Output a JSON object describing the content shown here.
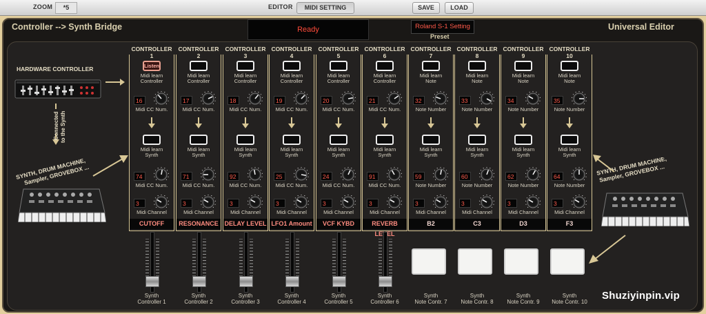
{
  "toolbar": {
    "zoom_label": "ZOOM",
    "zoom_value": "*5",
    "editor_label": "EDITOR",
    "midi_setting_label": "MIDI SETTING",
    "save_label": "SAVE",
    "load_label": "LOAD"
  },
  "header": {
    "title_left": "Controller --> Synth Bridge",
    "title_right": "Universal Editor",
    "status": "Ready",
    "preset_value": "Roland S-1 Setting",
    "preset_label": "Preset"
  },
  "left_panel": {
    "hardware_label": "HARDWARE CONTROLLER",
    "connected_line1": "Connected",
    "connected_line2": "to the Synth",
    "synth_label_line1": "SYNTH, DRUM MACHINE,",
    "synth_label_line2": "Sampler, GROVEBOX ..."
  },
  "right_panel": {
    "synth_label_line1": "SYNTH, DRUM MACHINE,",
    "synth_label_line2": "Sampler, GROVEBOX ..."
  },
  "controllers": [
    {
      "head": "CONTROLLER",
      "num": "1",
      "learn_ctrl": "Midi learn",
      "learn_ctrl2": "Controller",
      "listen": "Listen",
      "cc_in": "16",
      "cc_in_label": "Midi CC Num.",
      "learn_synth": "Midi learn",
      "learn_synth2": "Synth",
      "cc_out": "74",
      "cc_out_label": "Midi CC Num.",
      "channel": "3",
      "channel_label": "Midi Channel",
      "name": "CUTOFF",
      "fader_label1": "Synth",
      "fader_label2": "Controller 1"
    },
    {
      "head": "CONTROLLER",
      "num": "2",
      "learn_ctrl": "Midi learn",
      "learn_ctrl2": "Controller",
      "cc_in": "17",
      "cc_in_label": "Midi CC Num.",
      "learn_synth": "Midi learn",
      "learn_synth2": "Synth",
      "cc_out": "71",
      "cc_out_label": "Midi CC Num.",
      "channel": "3",
      "channel_label": "Midi Channel",
      "name": "RESONANCE",
      "fader_label1": "Synth",
      "fader_label2": "Controller 2"
    },
    {
      "head": "CONTROLLER",
      "num": "3",
      "learn_ctrl": "Midi learn",
      "learn_ctrl2": "Controller",
      "cc_in": "18",
      "cc_in_label": "Midi CC Num.",
      "learn_synth": "Midi learn",
      "learn_synth2": "Synth",
      "cc_out": "92",
      "cc_out_label": "Midi CC Num.",
      "channel": "3",
      "channel_label": "Midi Channel",
      "name": "DELAY LEVEL",
      "fader_label1": "Synth",
      "fader_label2": "Controller 3"
    },
    {
      "head": "CONTROLLER",
      "num": "4",
      "learn_ctrl": "Midi learn",
      "learn_ctrl2": "Controller",
      "cc_in": "19",
      "cc_in_label": "Midi CC Num.",
      "learn_synth": "Midi learn",
      "learn_synth2": "Synth",
      "cc_out": "25",
      "cc_out_label": "Midi CC Num.",
      "channel": "3",
      "channel_label": "Midi Channel",
      "name": "LFO1 Amount",
      "fader_label1": "Synth",
      "fader_label2": "Controller 4"
    },
    {
      "head": "CONTROLLER",
      "num": "5",
      "learn_ctrl": "Midi learn",
      "learn_ctrl2": "Controller",
      "cc_in": "20",
      "cc_in_label": "Midi CC Num.",
      "learn_synth": "Midi learn",
      "learn_synth2": "Synth",
      "cc_out": "24",
      "cc_out_label": "Midi CC Num.",
      "channel": "3",
      "channel_label": "Midi Channel",
      "name": "VCF KYBD",
      "fader_label1": "Synth",
      "fader_label2": "Controller 5"
    },
    {
      "head": "CONTROLLER",
      "num": "6",
      "learn_ctrl": "Midi learn",
      "learn_ctrl2": "Controller",
      "cc_in": "21",
      "cc_in_label": "Midi CC Num.",
      "learn_synth": "Midi learn",
      "learn_synth2": "Synth",
      "cc_out": "91",
      "cc_out_label": "Midi CC Num.",
      "channel": "3",
      "channel_label": "Midi Channel",
      "name": "REVERB LEVEL",
      "fader_label1": "Synth",
      "fader_label2": "Controller 6"
    },
    {
      "head": "CONTROLLER",
      "num": "7",
      "learn_ctrl": "Midi learn",
      "learn_ctrl2": "Note",
      "cc_in": "32",
      "cc_in_label": "Note Number",
      "learn_synth": "Midi learn",
      "learn_synth2": "Synth",
      "cc_out": "59",
      "cc_out_label": "Note Number",
      "channel": "3",
      "channel_label": "Midi Channel",
      "name": "B2",
      "fader_label1": "Synth",
      "fader_label2": "Note Contr. 7"
    },
    {
      "head": "CONTROLLER",
      "num": "8",
      "learn_ctrl": "Midi learn",
      "learn_ctrl2": "Note",
      "cc_in": "33",
      "cc_in_label": "Note Number",
      "learn_synth": "Midi learn",
      "learn_synth2": "Synth",
      "cc_out": "60",
      "cc_out_label": "Note Number",
      "channel": "3",
      "channel_label": "Midi Channel",
      "name": "C3",
      "fader_label1": "Synth",
      "fader_label2": "Note Contr. 8"
    },
    {
      "head": "CONTROLLER",
      "num": "9",
      "learn_ctrl": "Midi learn",
      "learn_ctrl2": "Note",
      "cc_in": "34",
      "cc_in_label": "Note Number",
      "learn_synth": "Midi learn",
      "learn_synth2": "Synth",
      "cc_out": "62",
      "cc_out_label": "Note Number",
      "channel": "3",
      "channel_label": "Midi Channel",
      "name": "D3",
      "fader_label1": "Synth",
      "fader_label2": "Note Contr. 9"
    },
    {
      "head": "CONTROLLER",
      "num": "10",
      "learn_ctrl": "Midi learn",
      "learn_ctrl2": "Note",
      "cc_in": "35",
      "cc_in_label": "Note Number",
      "learn_synth": "Midi learn",
      "learn_synth2": "Synth",
      "cc_out": "64",
      "cc_out_label": "Note Number",
      "channel": "3",
      "channel_label": "Midi Channel",
      "name": "F3",
      "fader_label1": "Synth",
      "fader_label2": "Note Contr. 10"
    }
  ],
  "watermark": "Shuziyinpin.vip",
  "colors": {
    "panel_border": "#d8c796",
    "lcd_text": "#ff5a4a",
    "frame": "#e3cf9e",
    "background": "#1a1816"
  }
}
